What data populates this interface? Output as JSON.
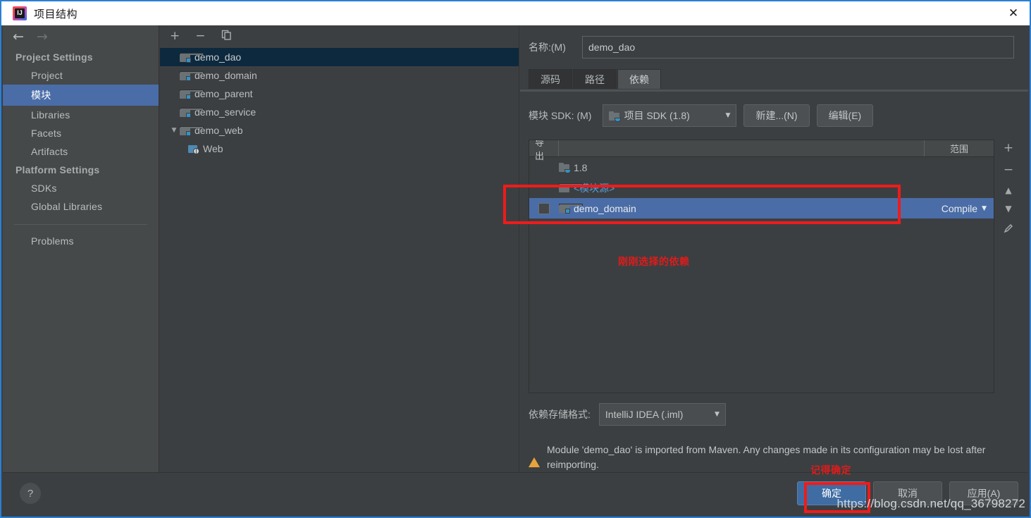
{
  "window": {
    "title": "项目结构",
    "close_label": "✕",
    "app_icon": "intellij-idea-icon"
  },
  "sidebar": {
    "nav": {
      "back": "←",
      "forward": "→"
    },
    "groups": [
      {
        "label": "Project Settings",
        "items": [
          {
            "label": "Project",
            "selected": false
          },
          {
            "label": "模块",
            "selected": true
          },
          {
            "label": "Libraries",
            "selected": false
          },
          {
            "label": "Facets",
            "selected": false
          },
          {
            "label": "Artifacts",
            "selected": false
          }
        ]
      },
      {
        "label": "Platform Settings",
        "items": [
          {
            "label": "SDKs",
            "selected": false
          },
          {
            "label": "Global Libraries",
            "selected": false
          }
        ]
      }
    ],
    "extra_items": [
      {
        "label": "Problems",
        "selected": false
      }
    ]
  },
  "tree": {
    "toolbar": {
      "add": "+",
      "remove": "−",
      "copy": "copy-icon"
    },
    "rows": [
      {
        "label": "demo_dao",
        "selected": true,
        "twisty": "",
        "indent": 0,
        "icon": "module-icon"
      },
      {
        "label": "demo_domain",
        "selected": false,
        "twisty": "",
        "indent": 0,
        "icon": "module-icon"
      },
      {
        "label": "demo_parent",
        "selected": false,
        "twisty": "",
        "indent": 0,
        "icon": "module-icon"
      },
      {
        "label": "demo_service",
        "selected": false,
        "twisty": "",
        "indent": 0,
        "icon": "module-icon"
      },
      {
        "label": "demo_web",
        "selected": false,
        "twisty": "▼",
        "indent": 0,
        "icon": "module-icon"
      },
      {
        "label": "Web",
        "selected": false,
        "twisty": "",
        "indent": 1,
        "icon": "web-facet-icon"
      }
    ]
  },
  "detail": {
    "name_label": "名称:(M)",
    "name_value": "demo_dao",
    "tabs": [
      {
        "label": "源码",
        "active": false
      },
      {
        "label": "路径",
        "active": false
      },
      {
        "label": "依赖",
        "active": true
      }
    ],
    "sdk_label": "模块 SDK: (M)",
    "sdk_value": "项目 SDK (1.8)",
    "new_button": "新建...(N)",
    "edit_button": "编辑(E)",
    "table": {
      "headers": {
        "export": "导出",
        "middle": "",
        "scope": "范围"
      },
      "rows": [
        {
          "name": "1.8",
          "scope": "",
          "selected": false,
          "checkbox": false,
          "icon": "sdk-icon",
          "style": "normal"
        },
        {
          "name": "<模块源>",
          "scope": "",
          "selected": false,
          "checkbox": false,
          "icon": "module-icon",
          "style": "blue"
        },
        {
          "name": "demo_domain",
          "scope": "Compile",
          "selected": true,
          "checkbox": true,
          "icon": "module-icon",
          "style": "normal"
        }
      ],
      "side_buttons": [
        "+",
        "−",
        "▲",
        "▼",
        "edit-pencil-icon"
      ]
    },
    "store_label": "依赖存储格式:",
    "store_value": "IntelliJ IDEA (.iml)",
    "warning": "Module 'demo_dao' is imported from Maven. Any changes made in its configuration may be lost after reimporting."
  },
  "annotations": {
    "dependency_note": "刚刚选择的依赖",
    "confirm_note": "记得确定",
    "watermark": "https://blog.csdn.net/qq_36798272",
    "highlight_color": "#ef1b1b"
  },
  "bottom": {
    "help": "?",
    "ok": "确定",
    "cancel": "取消",
    "apply": "应用(A)"
  }
}
